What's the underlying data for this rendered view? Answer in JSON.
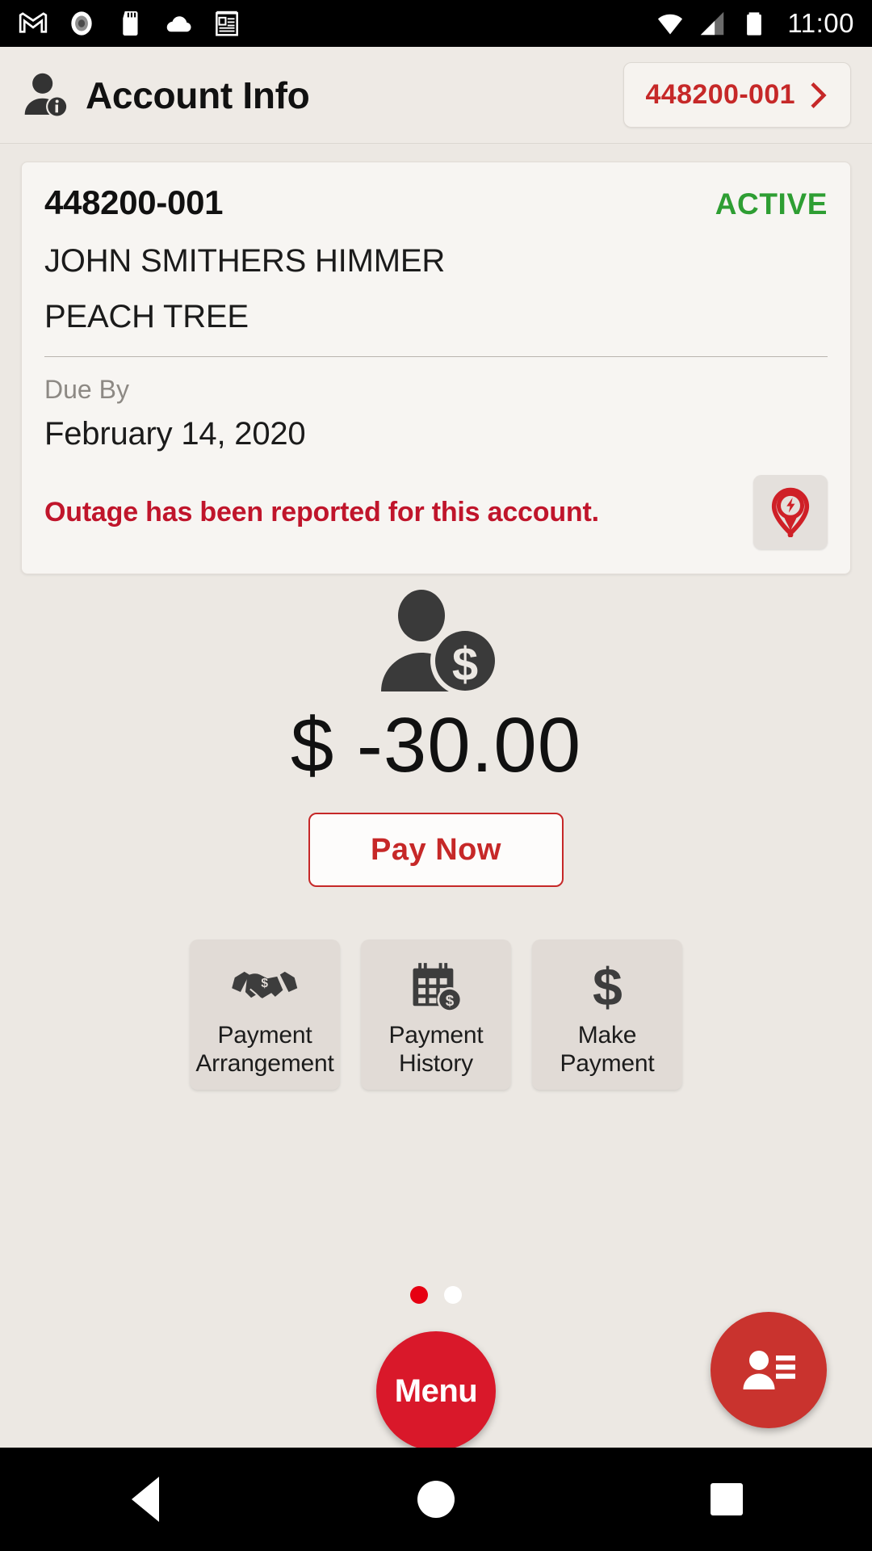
{
  "status_bar": {
    "icons": [
      "gmail-icon",
      "record-icon",
      "sd-card-icon",
      "cloud-icon",
      "news-icon"
    ],
    "wifi_icon": "wifi-icon",
    "signal_icon": "cellular-signal-icon",
    "battery_icon": "battery-icon",
    "clock": "11:00"
  },
  "app_bar": {
    "icon": "account-info-icon",
    "title": "Account Info",
    "account_chip": {
      "label": "448200-001",
      "chevron": "chevron-right-icon"
    }
  },
  "account_card": {
    "account_number": "448200-001",
    "status": "ACTIVE",
    "status_color": "#2e9e33",
    "customer_name": "JOHN SMITHERS HIMMER",
    "address": "PEACH TREE",
    "due_by_label": "Due By",
    "due_date": "February 14, 2020",
    "outage_message": "Outage has been reported for this account.",
    "outage_message_color": "#c0152b",
    "outage_icon": "outage-pin-icon"
  },
  "balance": {
    "icon": "customer-balance-icon",
    "amount": "$ -30.00",
    "pay_now_label": "Pay Now",
    "accent_color": "#c62828"
  },
  "tiles": [
    {
      "icon": "handshake-dollar-icon",
      "line1": "Payment",
      "line2": "Arrangement"
    },
    {
      "icon": "calendar-dollar-icon",
      "line1": "Payment",
      "line2": "History"
    },
    {
      "icon": "dollar-sign-icon",
      "line1": "Make",
      "line2": "Payment"
    }
  ],
  "pager": {
    "total": 2,
    "active_index": 0,
    "active_color": "#e60012",
    "inactive_color": "#ffffff"
  },
  "menu_fab": {
    "label": "Menu",
    "color": "#d9182a"
  },
  "contact_fab": {
    "icon": "contact-card-icon",
    "color": "#c9332e"
  },
  "nav_bar": {
    "back": "back-triangle-icon",
    "home": "home-circle-icon",
    "recents": "recents-square-icon"
  }
}
